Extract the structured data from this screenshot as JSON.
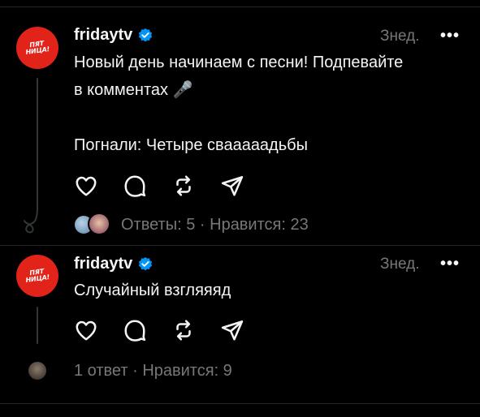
{
  "colors": {
    "background": "#000000",
    "text": "#f3f5f7",
    "muted": "#777777",
    "brand": "#e2231a",
    "verified": "#0095f6"
  },
  "posts": [
    {
      "username": "fridaytv",
      "avatar_logo": [
        "ПЯТ",
        "НИЦА!"
      ],
      "verified_icon": "verified-badge-icon",
      "time": "Знед.",
      "more": "•••",
      "text": "Новый день начинаем с песни! Подпевайте\nв комментах 🎤\n\nПогнали: Четыре свааааадьбы",
      "actions": [
        "heart-icon",
        "comment-icon",
        "repost-icon",
        "share-icon"
      ],
      "meta": "Ответы: 5 · Нравится: 23"
    },
    {
      "username": "fridaytv",
      "avatar_logo": [
        "ПЯТ",
        "НИЦА!"
      ],
      "verified_icon": "verified-badge-icon",
      "time": "Знед.",
      "more": "•••",
      "text": "Случайный взгляяяд",
      "actions": [
        "heart-icon",
        "comment-icon",
        "repost-icon",
        "share-icon"
      ],
      "meta": "1 ответ · Нравится: 9"
    }
  ]
}
